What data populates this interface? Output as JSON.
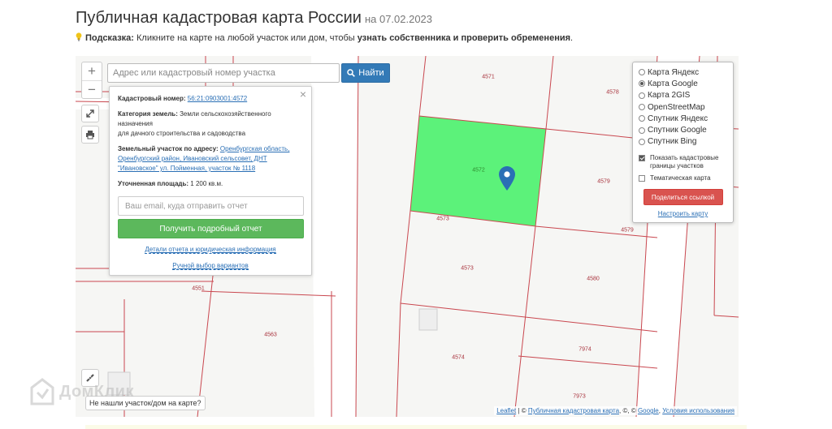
{
  "header": {
    "title": "Публичная кадастровая карта России",
    "date": "на 07.02.2023"
  },
  "hint": {
    "label": "Подсказка:",
    "text": " Кликните на карте на любой участок или дом, чтобы ",
    "bold": "узнать собственника и проверить обременения",
    "end": "."
  },
  "map": {
    "zoom_in": "+",
    "zoom_out": "−",
    "search_placeholder": "Адрес или кадастровый номер участка",
    "search_button": "Найти",
    "selected_color": "#5cf27a",
    "boundary_color": "#c9474f",
    "parcels": {
      "p4571": "4571",
      "p4578": "4578",
      "p4572": "4572",
      "p4579a": "4579",
      "p4573a": "4573",
      "p4579b": "4579",
      "p4573b": "4573",
      "p4580": "4580",
      "p4551": "4551",
      "p4563": "4563",
      "p4574": "4574",
      "p7974": "7974",
      "p7973": "7973"
    },
    "not_found": "Не нашли участок/дом на карте?",
    "attribution": {
      "leaflet": "Leaflet",
      "sep1": " | © ",
      "pkk": "Публичная кадастровая карта",
      "mid": ", ©, © ",
      "google": "Google",
      "sep2": ", ",
      "terms": "Условия использования"
    }
  },
  "popup": {
    "close": "×",
    "cad_label": "Кадастровый номер:",
    "cad_value": "56:21:0903001:4572",
    "category_label": "Категория земель:",
    "category_value": " Земли сельскохозяйственного назначения",
    "category_use": "для дачного строительства и садоводства",
    "address_label": "Земельный участок по адресу:",
    "address_value": "Оренбургская область, Оренбургский район, Ивановский сельсовет, ДНТ \"Ивановское\" ул. Пойменная, участок № 1118",
    "area_label": "Уточненная площадь:",
    "area_value": " 1 200 кв.м.",
    "email_placeholder": "Ваш email, куда отправить отчет",
    "report_button": "Получить подробный отчет",
    "details_link": "Детали отчета и юридическая информация",
    "manual_link": "Ручной выбор вариантов"
  },
  "layers": {
    "options": [
      {
        "label": "Карта Яндекс",
        "selected": false
      },
      {
        "label": "Карта Google",
        "selected": true
      },
      {
        "label": "Карта 2GIS",
        "selected": false
      },
      {
        "label": "OpenStreetMap",
        "selected": false
      },
      {
        "label": "Спутник Яндекс",
        "selected": false
      },
      {
        "label": "Спутник Google",
        "selected": false
      },
      {
        "label": "Спутник Bing",
        "selected": false
      }
    ],
    "show_boundaries": "Показать кадастровые границы участков",
    "thematic": "Тематическая карта",
    "share_button": "Поделиться ссылкой",
    "setup_link": "Настроить карту"
  },
  "watermark": "ДомКлик"
}
